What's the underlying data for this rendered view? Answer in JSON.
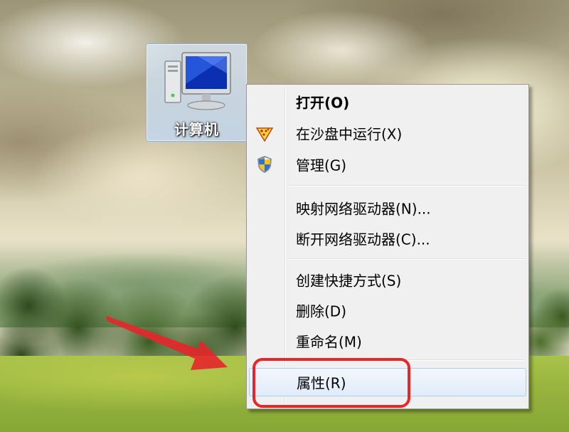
{
  "desktop": {
    "icon": {
      "label": "计算机",
      "glyph": "computer-icon"
    }
  },
  "context_menu": {
    "items": [
      {
        "label": "打开(O)",
        "default": true
      },
      {
        "label": "在沙盘中运行(X)",
        "icon": "sandbox-icon"
      },
      {
        "label": "管理(G)",
        "icon": "uac-shield-icon"
      },
      {
        "label": "映射网络驱动器(N)..."
      },
      {
        "label": "断开网络驱动器(C)..."
      },
      {
        "label": "创建快捷方式(S)"
      },
      {
        "label": "删除(D)"
      },
      {
        "label": "重命名(M)"
      },
      {
        "label": "属性(R)",
        "highlighted": true
      }
    ]
  },
  "annotation": {
    "color": "#e5262b"
  },
  "colors": {
    "menu_background": "#f0f0f0",
    "menu_border": "#979797",
    "selection_border": "#aeccf2",
    "icon_selection": "#c1dbfc"
  }
}
